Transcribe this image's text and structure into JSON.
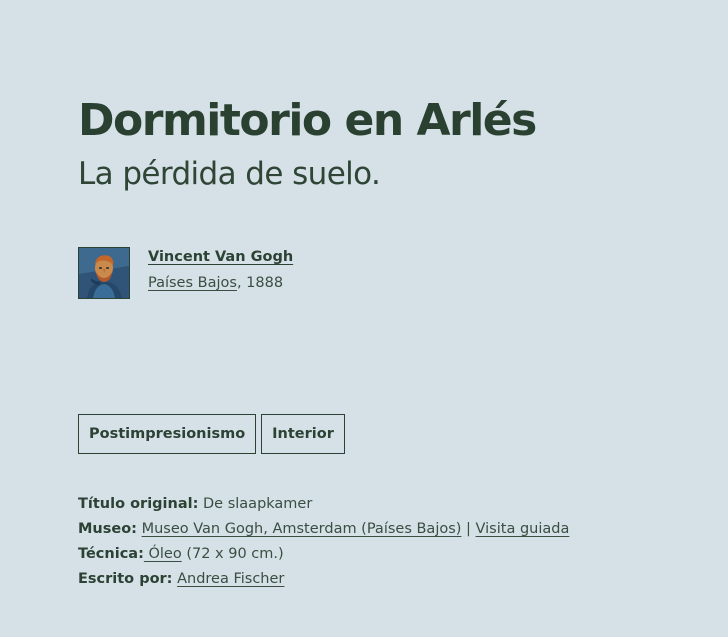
{
  "artwork": {
    "title": "Dormitorio en Arlés",
    "subtitle": "La pérdida de suelo."
  },
  "author": {
    "name": "Vincent Van Gogh",
    "country": "Países Bajos",
    "year_text": ", 1888",
    "avatar_icon": "portrait-thumbnail"
  },
  "tags": [
    {
      "label": "Postimpresionismo"
    },
    {
      "label": "Interior"
    }
  ],
  "details": {
    "original_title": {
      "label": "Título original:",
      "value": " De slaapkamer"
    },
    "museum": {
      "label": "Museo:",
      "link": "Museo Van Gogh, Amsterdam (Países Bajos)",
      "separator": " | ",
      "tour_link": "Visita guiada"
    },
    "technique": {
      "label": "Técnica:",
      "link": " Óleo",
      "value": " (72 x 90 cm.)"
    },
    "written_by": {
      "label": "Escrito por:",
      "link": "Andrea Fischer"
    }
  },
  "colors": {
    "background": "#d5e1e6",
    "text": "#2c4234"
  }
}
